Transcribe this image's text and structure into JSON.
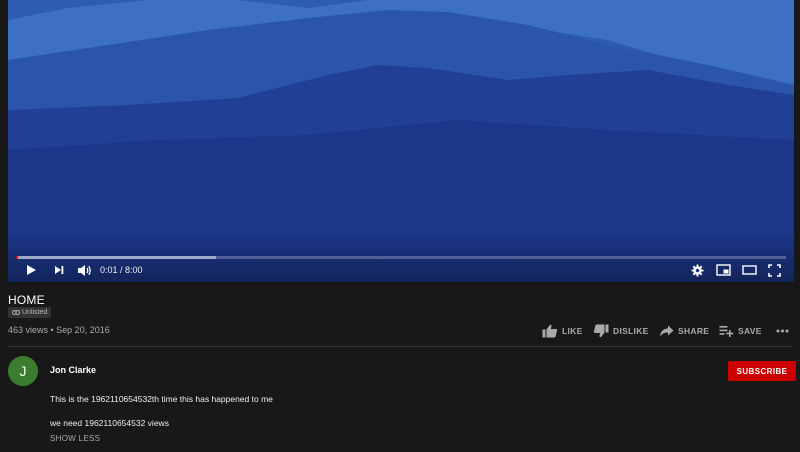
{
  "player": {
    "progress_fraction": 0.002,
    "buffered_fraction": 0.26,
    "time_text": "0:01 / 8:00",
    "icons": [
      "play-icon",
      "next-icon",
      "volume-icon",
      "settings-icon",
      "miniplayer-icon",
      "theater-icon",
      "fullscreen-icon"
    ]
  },
  "video": {
    "title": "HOME",
    "visibility_badge": "Unlisted",
    "meta": "463 views • Sep 20, 2016"
  },
  "actions": {
    "like": "LIKE",
    "dislike": "DISLIKE",
    "share": "SHARE",
    "save": "SAVE"
  },
  "channel": {
    "avatar_letter": "J",
    "name": "Jon Clarke",
    "subscribe_label": "SUBSCRIBE"
  },
  "description": {
    "line1": "This is the 1962110654532th time this has happened to me",
    "line2": "we need 1962110654532 views",
    "toggle": "SHOW LESS"
  },
  "colors": {
    "background": "#181818",
    "subscribe": "#cc0000",
    "progress": "#ff0000",
    "avatar": "#3a7d2f"
  }
}
